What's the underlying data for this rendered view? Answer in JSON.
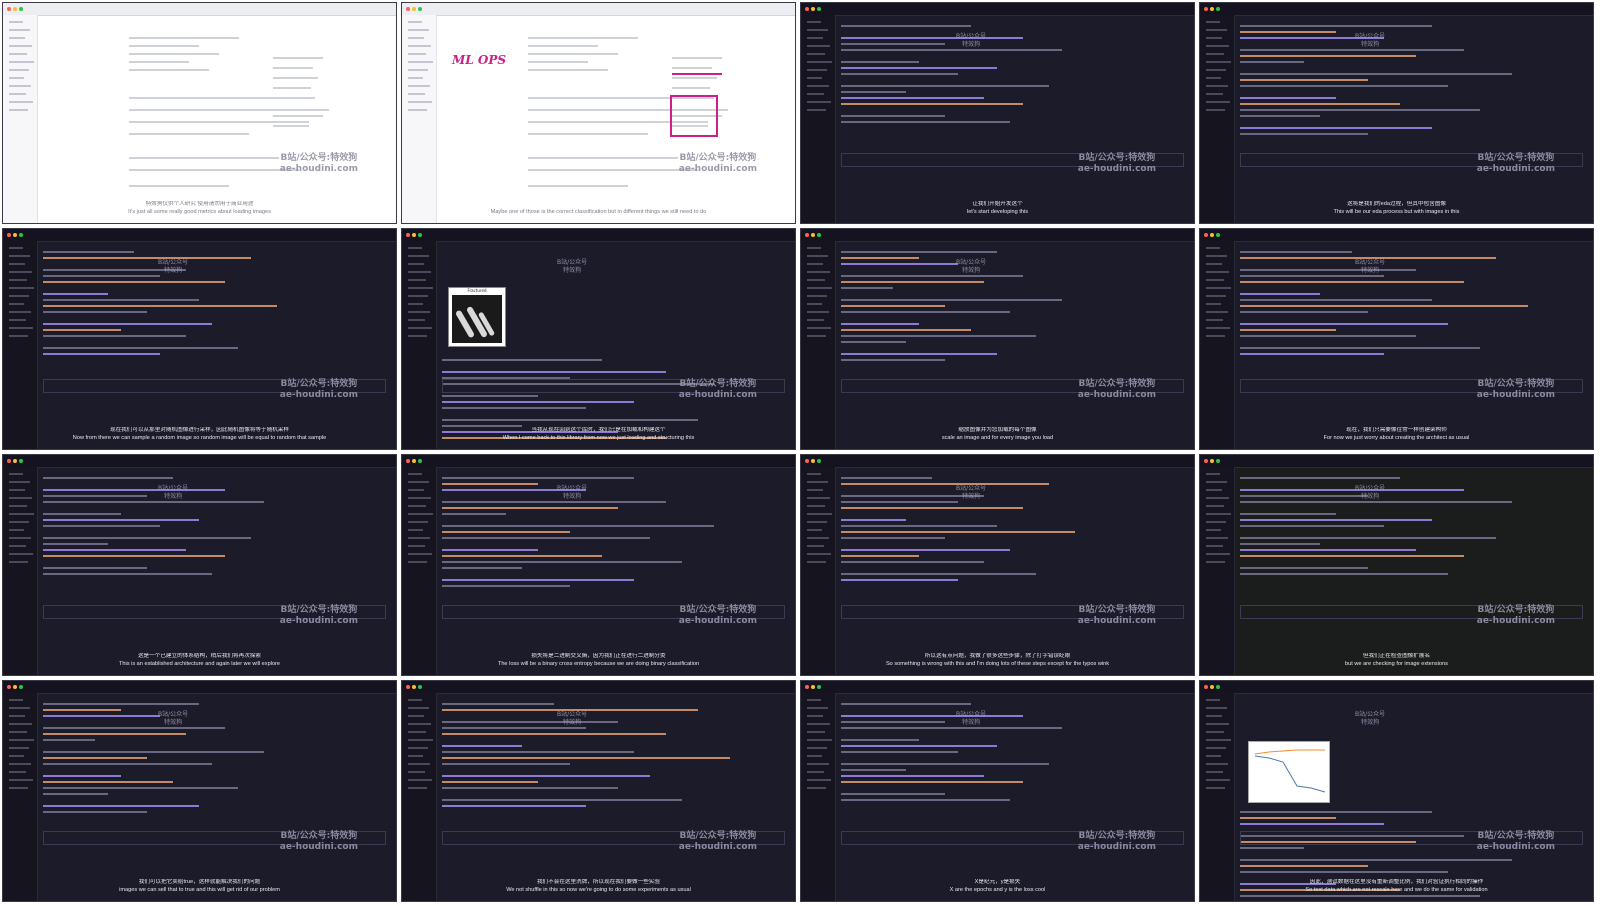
{
  "watermark": {
    "top": "B站/公众号:特效狗",
    "bottom": "ae-houdini.com",
    "small_line1": "B站/公众号",
    "small_line2": "特效狗"
  },
  "tiles": [
    {
      "kind": "light",
      "zh": "特效狗仅供个人研究 使用请勿用于商业用途",
      "en": "It's just all some really good metrics about loading images"
    },
    {
      "kind": "light-annot",
      "zh": "",
      "en": "Maybe one of those is the correct classification but in different things we still need to do",
      "annotation": "ML OPS"
    },
    {
      "kind": "dark",
      "zh": "让我们开始开发这个",
      "en": "let's start developing this"
    },
    {
      "kind": "dark",
      "zh": "这将是我们的eda过程，但其中包含图像",
      "en": "This will be our eda process but with images in this"
    },
    {
      "kind": "dark",
      "zh": "现在我们可以从那里对随机图像进行采样，因此随机图像将等于随机采样",
      "en": "Now from there we can sample a random image so random image will be equal to random that sample"
    },
    {
      "kind": "dark-xray",
      "zh": "当我从现在回到这个库时，我们只是在加载和构建这个",
      "en": "When I come back to this library from now we just loading and structuring this",
      "panel_title": "Fractured"
    },
    {
      "kind": "dark",
      "zh": "缩放图像并为您加载的每个图像",
      "en": "scale an image and for every image you load"
    },
    {
      "kind": "dark",
      "zh": "现在，我们只需要像往常一样创建架构师",
      "en": "For now we just worry about creating the architect as usual"
    },
    {
      "kind": "dark",
      "zh": "这是一个已建立的体系结构，稍后我们将再次探索",
      "en": "This is an established architecture and again later we will explore"
    },
    {
      "kind": "dark",
      "zh": "损失将是二进制交叉熵，因为我们正在进行二进制分类",
      "en": "The loss will be a binary cross entropy because we are doing binary classification"
    },
    {
      "kind": "dark",
      "zh": "所以这有点问题，我做了很多这些步骤，除了打字错误眨眼",
      "en": "So something is wrong with this and I'm doing lots of these steps except for the typos wink"
    },
    {
      "kind": "dark-green",
      "zh": "但我们正在检查图像扩展名",
      "en": "but we are checking for image extensions"
    },
    {
      "kind": "dark",
      "zh": "我们可以把它卖给true，这样就能解决我们的问题",
      "en": "images we can sell that to true and this will get rid of our problem"
    },
    {
      "kind": "dark",
      "zh": "我们不会在这里洗牌，所以现在我们要做一些实验",
      "en": "We not shuffle in this so now we're going to do some experiments as usual"
    },
    {
      "kind": "dark",
      "zh": "X是纪元，y是损失",
      "en": "X are the epochs and y is the loss cool"
    },
    {
      "kind": "dark-plot",
      "zh": "因此，测试数据在这里没有重新调整比例，我们对验证执行相同的操作",
      "en": "So test data which are not rescale here and we do the same for validation"
    }
  ]
}
